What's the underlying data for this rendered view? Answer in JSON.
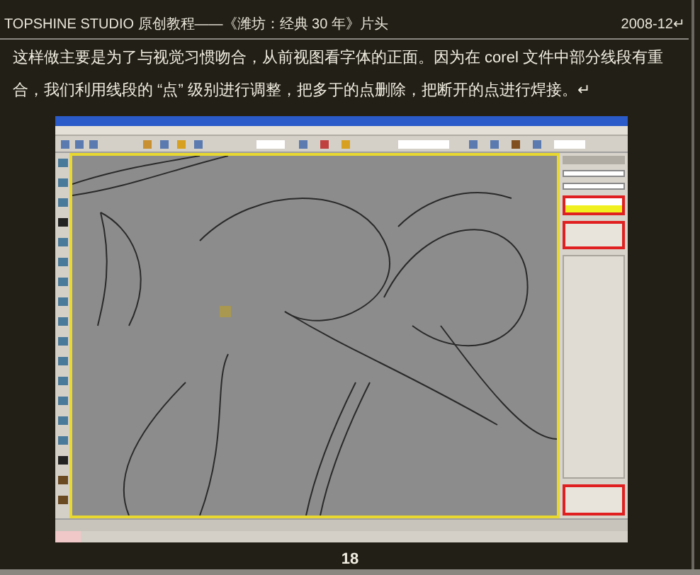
{
  "header": {
    "title": "TOPSHINE STUDIO 原创教程——《潍坊：经典 30 年》片头",
    "date": "2008-12↵"
  },
  "body_text": "这样做主要是为了与视觉习惯吻合，从前视图看字体的正面。因为在 corel 文件中部分线段有重合，我们利用线段的 “点” 级别进行调整，把多于的点删除，把断开的点进行焊接。↵",
  "page_number": "18"
}
